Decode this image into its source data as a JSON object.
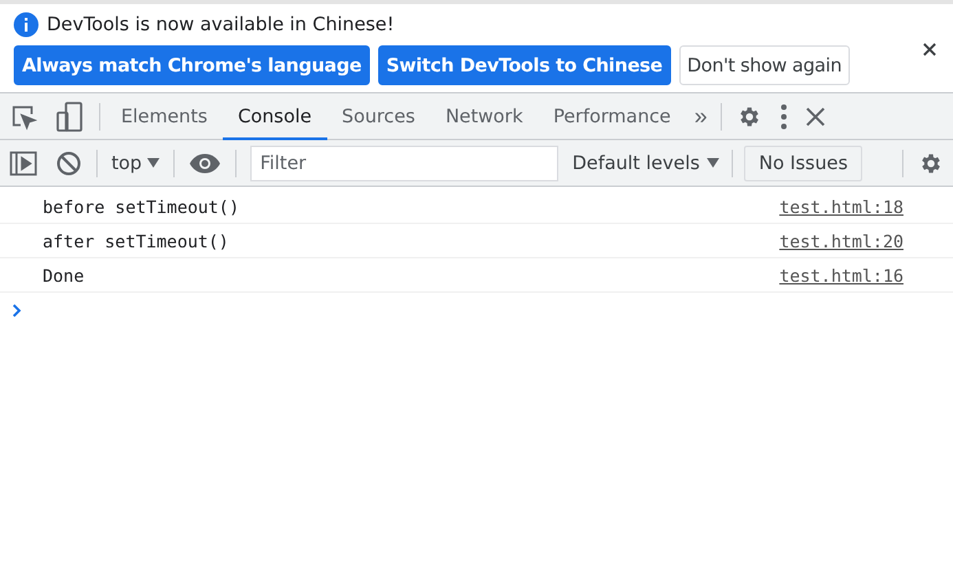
{
  "infobar": {
    "message": "DevTools is now available in Chinese!",
    "buttons": [
      {
        "label": "Always match Chrome's language",
        "kind": "primary"
      },
      {
        "label": "Switch DevTools to Chinese",
        "kind": "primary"
      },
      {
        "label": "Don't show again",
        "kind": "secondary"
      }
    ]
  },
  "tabs": [
    {
      "label": "Elements",
      "selected": false
    },
    {
      "label": "Console",
      "selected": true
    },
    {
      "label": "Sources",
      "selected": false
    },
    {
      "label": "Network",
      "selected": false
    },
    {
      "label": "Performance",
      "selected": false
    }
  ],
  "more_tabs": "»",
  "toolbar": {
    "context": "top",
    "filter": {
      "placeholder": "Filter"
    },
    "levels": "Default levels",
    "issues": "No Issues"
  },
  "messages": [
    {
      "text": "before setTimeout()",
      "source": "test.html:18"
    },
    {
      "text": "after setTimeout()",
      "source": "test.html:20"
    },
    {
      "text": "Done",
      "source": "test.html:16"
    }
  ]
}
